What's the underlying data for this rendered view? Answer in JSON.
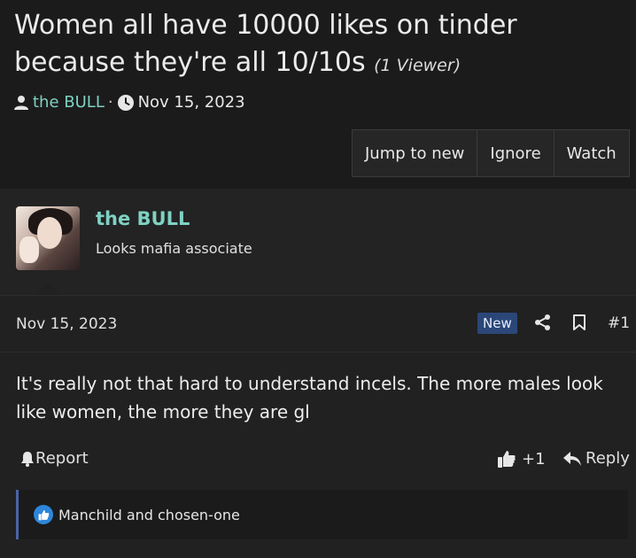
{
  "thread": {
    "title": "Women all have 10000 likes on tinder because they're all 10/10s",
    "viewers": "(1 Viewer)",
    "author": "the BULL",
    "date": "Nov 15, 2023"
  },
  "buttons": {
    "jump": "Jump to new",
    "ignore": "Ignore",
    "watch": "Watch"
  },
  "post": {
    "username": "the BULL",
    "user_title": "Looks mafia associate",
    "date": "Nov 15, 2023",
    "badge": "New",
    "number": "#1",
    "message": "It's really not that hard to understand incels. The more males look like women, the more they are gl",
    "report": "Report",
    "like_count": "+1",
    "reply": "Reply",
    "reactions": "Manchild and chosen-one"
  },
  "colors": {
    "accent": "#7fd1c3",
    "badge": "#2b4778",
    "reaction_bar": "#4a64a8",
    "like_icon": "#2d86d9"
  },
  "icons": [
    "user-icon",
    "clock-icon",
    "share-icon",
    "bookmark-icon",
    "bell-icon",
    "thumbs-up-icon",
    "reply-icon",
    "like-reaction-icon"
  ]
}
